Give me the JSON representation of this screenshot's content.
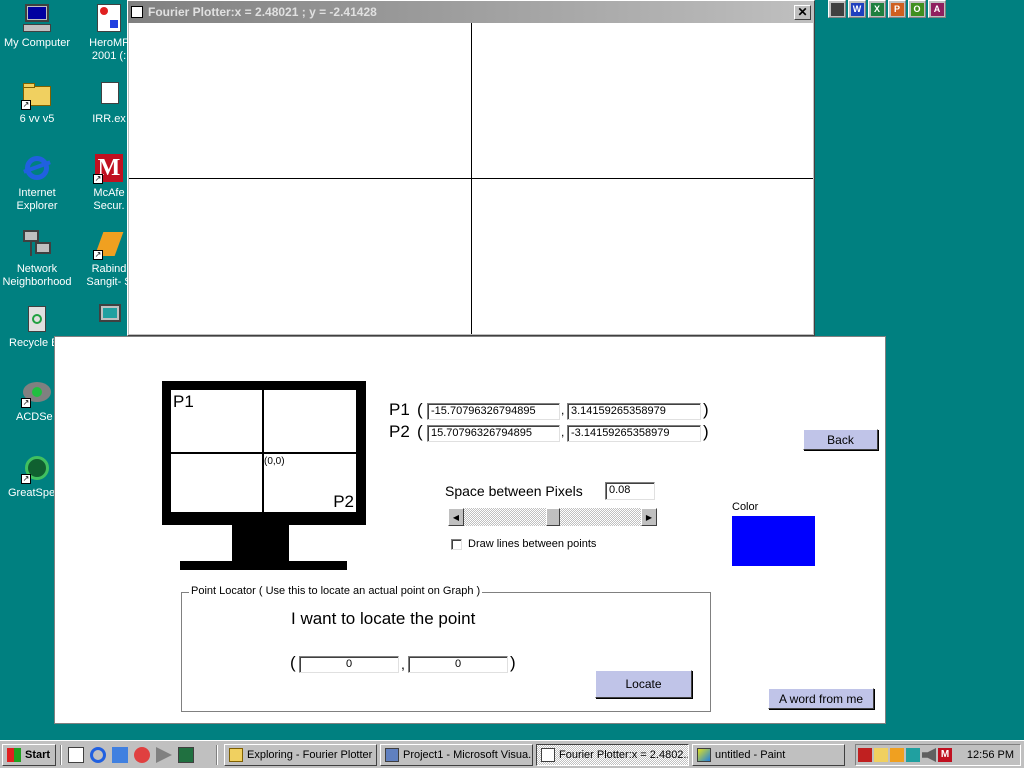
{
  "desktop": {
    "icons": [
      {
        "label": "My Computer"
      },
      {
        "label": "6 vv v5"
      },
      {
        "label": "Internet\nExplorer"
      },
      {
        "label": "Network\nNeighborhood"
      },
      {
        "label": "Recycle B"
      },
      {
        "label": "ACDSe"
      },
      {
        "label": "GreatSpe"
      },
      {
        "label": "HeroMF\n2001 (:"
      },
      {
        "label": "IRR.ex"
      },
      {
        "label": "McAfe\nSecur."
      },
      {
        "label": "Rabind\nSangit- S"
      },
      {
        "label": ""
      }
    ]
  },
  "office_bar": {
    "buttons": [
      {
        "icon": "office-shortcut-icon",
        "color": "#404040"
      },
      {
        "icon": "word-icon",
        "color": "#1f3fbf",
        "glyph": "W"
      },
      {
        "icon": "excel-icon",
        "color": "#1f7f3f",
        "glyph": "X"
      },
      {
        "icon": "powerpoint-icon",
        "color": "#cf5f1f",
        "glyph": "P"
      },
      {
        "icon": "outlook-icon",
        "color": "#3f8f1f",
        "glyph": "O"
      },
      {
        "icon": "access-icon",
        "color": "#8f1f5f",
        "glyph": "A"
      }
    ]
  },
  "plot_window": {
    "title": "Fourier Plotter:x = 2.48021 ; y = -2.41428",
    "close": "✕"
  },
  "control_window": {
    "screen_origin": "(0,0)",
    "screen_p1": "P1",
    "screen_p2": "P2",
    "p1_label": "P1",
    "p2_label": "P2",
    "open_paren": "(",
    "close_paren": ")",
    "comma": ",",
    "p1_x": "-15.70796326794895",
    "p1_y": "3.14159265358979",
    "p2_x": "15.70796326794895",
    "p2_y": "-3.14159265358979",
    "back_label": "Back",
    "space_label": "Space between Pixels",
    "space_value": "0.08",
    "draw_lines_label": "Draw lines between points",
    "draw_lines_checked": false,
    "color_label": "Color",
    "color_value": "#0000ff",
    "slider_value": 0.5,
    "locator": {
      "legend": "Point Locator ( Use this to locate an actual point on Graph )",
      "heading": "I want to locate the point",
      "x": "0",
      "y": "0",
      "locate_label": "Locate"
    },
    "word_label": "A word from me"
  },
  "taskbar": {
    "start_label": "Start",
    "tasks": [
      {
        "label": "Exploring - Fourier Plotter",
        "active": false
      },
      {
        "label": "Project1 - Microsoft Visua...",
        "active": false
      },
      {
        "label": "Fourier Plotter:x = 2.4802...",
        "active": true
      },
      {
        "label": "untitled - Paint",
        "active": false
      }
    ],
    "clock": "12:56 PM"
  }
}
